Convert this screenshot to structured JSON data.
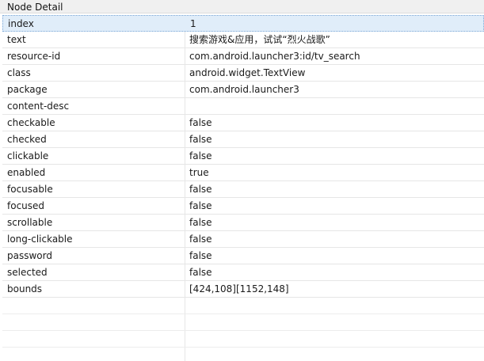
{
  "panel": {
    "title": "Node Detail"
  },
  "rows": [
    {
      "key": "index",
      "value": "1"
    },
    {
      "key": "text",
      "value": "搜索游戏&应用，试试“烈火战歌”"
    },
    {
      "key": "resource-id",
      "value": "com.android.launcher3:id/tv_search"
    },
    {
      "key": "class",
      "value": "android.widget.TextView"
    },
    {
      "key": "package",
      "value": "com.android.launcher3"
    },
    {
      "key": "content-desc",
      "value": ""
    },
    {
      "key": "checkable",
      "value": "false"
    },
    {
      "key": "checked",
      "value": "false"
    },
    {
      "key": "clickable",
      "value": "false"
    },
    {
      "key": "enabled",
      "value": "true"
    },
    {
      "key": "focusable",
      "value": "false"
    },
    {
      "key": "focused",
      "value": "false"
    },
    {
      "key": "scrollable",
      "value": "false"
    },
    {
      "key": "long-clickable",
      "value": "false"
    },
    {
      "key": "password",
      "value": "false"
    },
    {
      "key": "selected",
      "value": "false"
    },
    {
      "key": "bounds",
      "value": "[424,108][1152,148]"
    }
  ]
}
